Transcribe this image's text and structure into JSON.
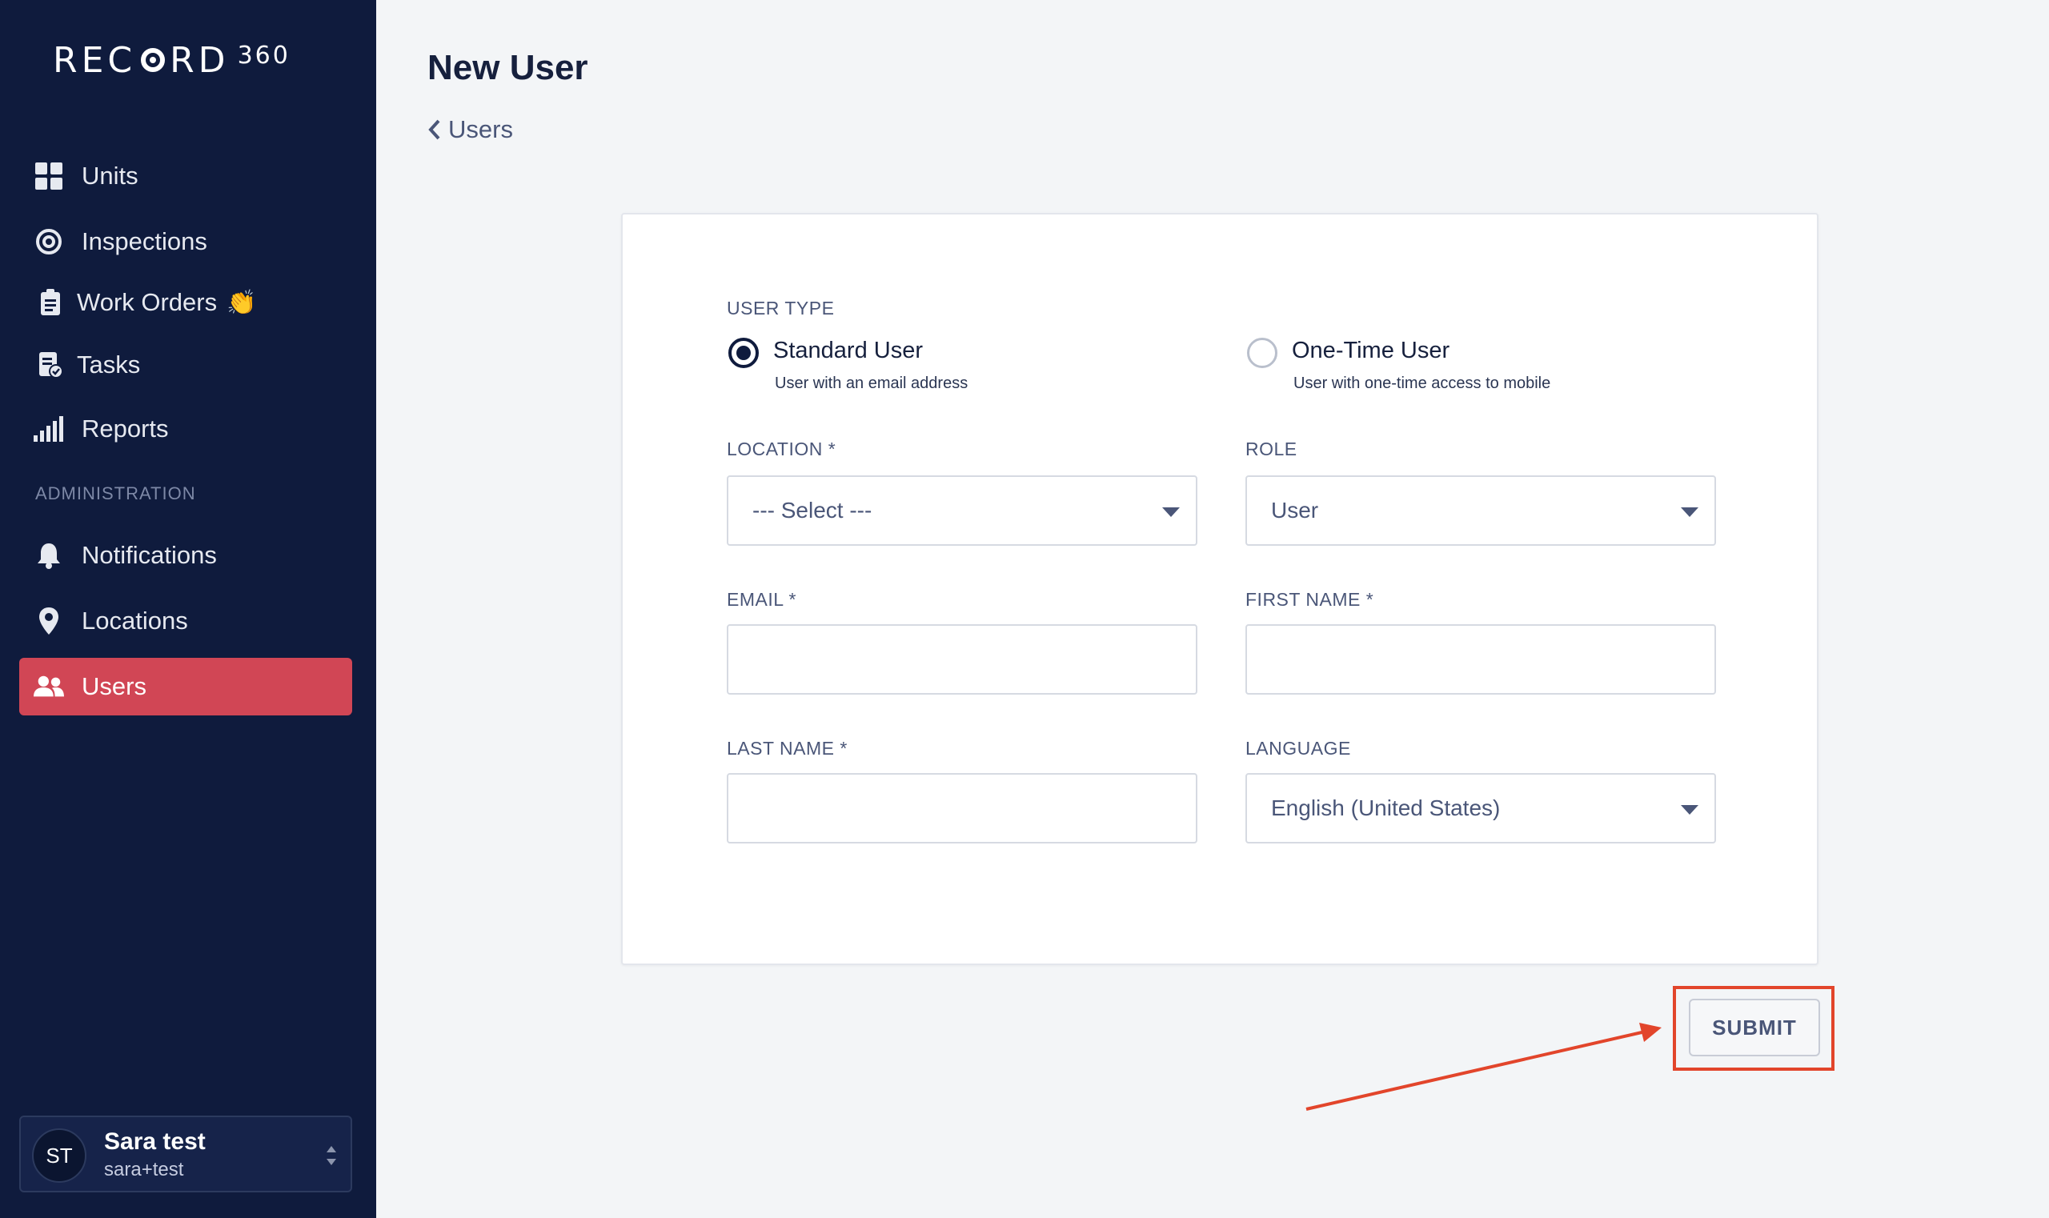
{
  "app": {
    "logo_text_1": "REC",
    "logo_text_2": "RD",
    "logo_sup": "360"
  },
  "sidebar": {
    "items": [
      {
        "label": "Units",
        "icon": "grid-icon"
      },
      {
        "label": "Inspections",
        "icon": "target-icon"
      },
      {
        "label": "Work Orders",
        "icon": "clipboard-icon",
        "emoji": "👏"
      },
      {
        "label": "Tasks",
        "icon": "task-icon"
      },
      {
        "label": "Reports",
        "icon": "signal-bars-icon"
      }
    ],
    "admin_label": "ADMINISTRATION",
    "admin_items": [
      {
        "label": "Notifications",
        "icon": "bell-icon"
      },
      {
        "label": "Locations",
        "icon": "map-pin-icon"
      },
      {
        "label": "Users",
        "icon": "users-icon",
        "active": true
      }
    ],
    "user": {
      "initials": "ST",
      "name": "Sara test",
      "email": "sara+test"
    }
  },
  "header": {
    "title": "New User",
    "breadcrumb": "Users"
  },
  "form": {
    "user_type_label": "USER TYPE",
    "user_types": [
      {
        "title": "Standard User",
        "subtitle": "User with an email address",
        "selected": true
      },
      {
        "title": "One-Time User",
        "subtitle": "User with one-time access to mobile",
        "selected": false
      }
    ],
    "location_label": "LOCATION *",
    "location_value": "--- Select ---",
    "role_label": "ROLE",
    "role_value": "User",
    "email_label": "EMAIL *",
    "email_value": "",
    "first_name_label": "FIRST NAME *",
    "first_name_value": "",
    "last_name_label": "LAST NAME *",
    "last_name_value": "",
    "language_label": "LANGUAGE",
    "language_value": "English (United States)"
  },
  "actions": {
    "submit_label": "SUBMIT"
  },
  "colors": {
    "sidebar_bg": "#0f1b3d",
    "active_item": "#d14655",
    "highlight": "#e2452b"
  }
}
